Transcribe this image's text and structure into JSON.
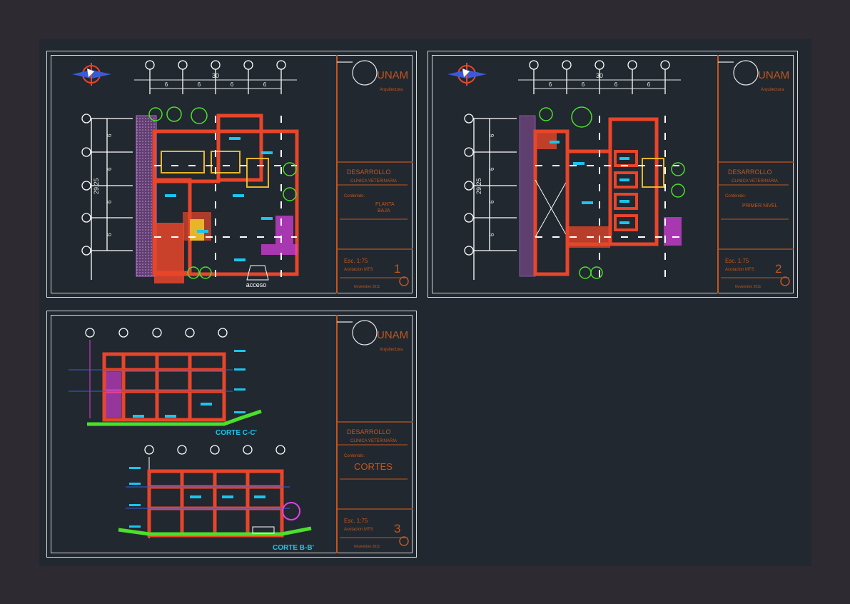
{
  "colors": {
    "background": "#2d2a31",
    "canvas": "#212830",
    "wall": "#e8452a",
    "accent_cyan": "#19c6ee",
    "ground": "#4be02a",
    "magenta": "#e23fe6",
    "titleblock_line": "#c4561c",
    "axis": "#ffffff",
    "dim": "#e8e8e8"
  },
  "titleblock": {
    "brand": "UNAM",
    "brand_sub": "Arquitectura",
    "project": "DESARROLLO",
    "project_sub": "CLINICA VETERINARIA",
    "contains_label": "Contenido:",
    "scale_label": "Esc. 1:75",
    "units_label": "Acotacion MTS",
    "date_label": "Noviembre 2011"
  },
  "sheets": [
    {
      "id": "planta-baja",
      "content_line1": "PLANTA",
      "content_line2": "BAJA",
      "number": "1"
    },
    {
      "id": "primer-nivel",
      "content_line1": "PRIMER NIVEL",
      "content_line2": "",
      "number": "2"
    },
    {
      "id": "cortes",
      "content_line1": "CORTES",
      "content_line2": "",
      "number": "3"
    }
  ],
  "plans": {
    "overall_width": "30",
    "bay_width": "6",
    "overall_depth": "29.25",
    "access_label": "acceso"
  },
  "sections": {
    "section_cc": "CORTE C-C'",
    "section_bb": "CORTE B-B'"
  }
}
